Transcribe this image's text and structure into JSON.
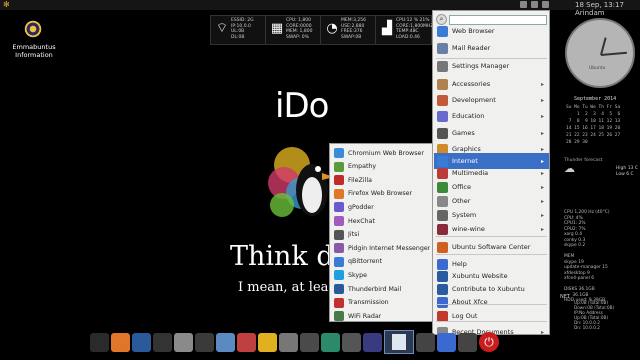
{
  "top_panel": {
    "logo_icon": "emmabuntus-fleur-icon",
    "clock": "18 Sep, 13:17",
    "user": "Arindam"
  },
  "desktop_icon": {
    "label": "Emmabuntus Information"
  },
  "wallpaper": {
    "title": "iDo",
    "think": "Think di",
    "mean": "I mean, at least I"
  },
  "sysmon": [
    {
      "icon": "wifi-icon",
      "text": "ESSID: 2G\nIP:10.0.0\nUL:0B\nDL:0B"
    },
    {
      "icon": "cpu-icon",
      "text": "CPU: 1,800\nCORE:0000\nMEM: 1,800\nSWAP: 0%"
    },
    {
      "icon": "memory-icon",
      "text": "MEM:3,256\nUSE:2,880\nFREE:376\nSWAP:0B"
    },
    {
      "icon": "chart-icon",
      "text": "CPU:12 % 21%\nCORE:1,800MHZ\nTEMP:48C\nLOAD:0.46"
    }
  ],
  "main_menu": {
    "search_value": "",
    "items": [
      {
        "label": "Web Browser",
        "icon": "web-browser-icon",
        "color": "#3a7bd5",
        "sub": false
      },
      {
        "label": "Mail Reader",
        "icon": "mail-icon",
        "color": "#6a7fa6",
        "sub": false
      },
      {
        "label": "Settings Manager",
        "icon": "settings-icon",
        "color": "#777777",
        "sub": false
      },
      {
        "label": "Accessories",
        "icon": "accessories-icon",
        "color": "#b08050",
        "sub": true
      },
      {
        "label": "Development",
        "icon": "development-icon",
        "color": "#c05a3a",
        "sub": true
      },
      {
        "label": "Education",
        "icon": "education-icon",
        "color": "#6a6acc",
        "sub": true
      },
      {
        "label": "Games",
        "icon": "games-icon",
        "color": "#555555",
        "sub": true
      },
      {
        "label": "Graphics",
        "icon": "graphics-icon",
        "color": "#d08a2a",
        "sub": true
      },
      {
        "label": "Internet",
        "icon": "internet-icon",
        "color": "#3a7bd5",
        "sub": true
      },
      {
        "label": "Multimedia",
        "icon": "multimedia-icon",
        "color": "#bb3a3a",
        "sub": true
      },
      {
        "label": "Office",
        "icon": "office-icon",
        "color": "#3a8a3a",
        "sub": true
      },
      {
        "label": "Other",
        "icon": "other-icon",
        "color": "#888888",
        "sub": true
      },
      {
        "label": "System",
        "icon": "system-icon",
        "color": "#666666",
        "sub": true
      },
      {
        "label": "wine-wine",
        "icon": "wine-icon",
        "color": "#8a2a3a",
        "sub": true
      },
      {
        "label": "Ubuntu Software Center",
        "icon": "software-center-icon",
        "color": "#d06020",
        "sub": false
      },
      {
        "label": "Help",
        "icon": "help-icon",
        "color": "#3a6ad0",
        "sub": false
      },
      {
        "label": "Xubuntu Website",
        "icon": "xubuntu-icon",
        "color": "#2a5aa0",
        "sub": false
      },
      {
        "label": "Contribute to Xubuntu",
        "icon": "contribute-icon",
        "color": "#2a5aa0",
        "sub": false
      },
      {
        "label": "About Xfce",
        "icon": "about-xfce-icon",
        "color": "#3a6ad0",
        "sub": false
      },
      {
        "label": "Log Out",
        "icon": "log-out-icon",
        "color": "#c0392b",
        "sub": false
      },
      {
        "label": "Recent Documents",
        "icon": "recent-documents-icon",
        "color": "#888888",
        "sub": true
      }
    ]
  },
  "submenu": {
    "items": [
      {
        "label": "Chromium Web Browser",
        "icon": "chromium-icon",
        "color": "#3a8ad8"
      },
      {
        "label": "Empathy",
        "icon": "empathy-icon",
        "color": "#5a9a3a"
      },
      {
        "label": "FileZilla",
        "icon": "filezilla-icon",
        "color": "#c02a2a"
      },
      {
        "label": "Firefox Web Browser",
        "icon": "firefox-icon",
        "color": "#e0762a"
      },
      {
        "label": "gPodder",
        "icon": "gpodder-icon",
        "color": "#6a5acd"
      },
      {
        "label": "HexChat",
        "icon": "hexchat-icon",
        "color": "#a05ac0"
      },
      {
        "label": "Jitsi",
        "icon": "jitsi-icon",
        "color": "#555555"
      },
      {
        "label": "Pidgin Internet Messenger",
        "icon": "pidgin-icon",
        "color": "#8a5aaa"
      },
      {
        "label": "qBittorrent",
        "icon": "qbittorrent-icon",
        "color": "#3a7bd5"
      },
      {
        "label": "Skype",
        "icon": "skype-icon",
        "color": "#1ea0e0"
      },
      {
        "label": "Thunderbird Mail",
        "icon": "thunderbird-icon",
        "color": "#2a5a9a"
      },
      {
        "label": "Transmission",
        "icon": "transmission-icon",
        "color": "#c03030"
      },
      {
        "label": "WiFi Radar",
        "icon": "wifi-radar-icon",
        "color": "#4a7a4a"
      }
    ]
  },
  "conky": {
    "clock_label": "Ubuntu",
    "calendar_title": "September 2014",
    "calendar": "Su Mo Tu We Th Fr Sa\n    1  2  3  4  5  6\n 7  8  9 10 11 12 13\n14 15 16 17 18 19 20\n21 22 23 24 25 26 27\n28 29 30",
    "weather_title": "Thunder forecast",
    "weather_high": "High 13 C",
    "weather_low": "Low 6 C",
    "stats": "CPU 1,200 Hz (40°C)\nCPU: 4%\nCPU1: 2%\nCPU2: 7%\nxorg 0.4\nconky 0.3\nskype 0.2\n\nMEM\nskype 19\nupdate-manager 15\nxfdesktop 9\nxfce4-panel 6\n\nDISKS 36.1GB\n      36.1GB\nHDD used: 9.39GB",
    "net_label": "NET",
    "net_stats": "Up:0B (Total:0B)\nDown:0B (Total:0B)\nIP:No Address\nUp:0B (Total:0B)\nDn: 10.0.0.2\nDn: 10.0.0.2"
  },
  "dock": [
    {
      "icon": "ido-home-icon",
      "color": "#2a2a2a"
    },
    {
      "icon": "firefox-icon",
      "color": "#e0762a"
    },
    {
      "icon": "thunderbird-icon",
      "color": "#2a5a9a"
    },
    {
      "icon": "terminal-icon",
      "color": "#333333"
    },
    {
      "icon": "file-manager-icon",
      "color": "#8a8a8a"
    },
    {
      "icon": "media-player-icon",
      "color": "#3a3a3a"
    },
    {
      "icon": "libreoffice-icon",
      "color": "#5a8ac0"
    },
    {
      "icon": "cd-burner-icon",
      "color": "#c04040"
    },
    {
      "icon": "favorites-star-icon",
      "color": "#e0b020"
    },
    {
      "icon": "settings-icon",
      "color": "#777777"
    },
    {
      "icon": "system-icon",
      "color": "#4a4a4a"
    },
    {
      "icon": "palette-icon",
      "color": "#2a8a6a"
    },
    {
      "icon": "disk-icon",
      "color": "#555555"
    },
    {
      "icon": "network-icon",
      "color": "#3a3a80"
    },
    {
      "icon": "window-icon",
      "color": "#2b3a52"
    },
    {
      "icon": "files-icon",
      "color": "#444444"
    },
    {
      "icon": "chat-icon",
      "color": "#3a6ad0"
    },
    {
      "icon": "users-icon",
      "color": "#444444"
    },
    {
      "icon": "power-icon",
      "color": "#c91e1e"
    }
  ]
}
